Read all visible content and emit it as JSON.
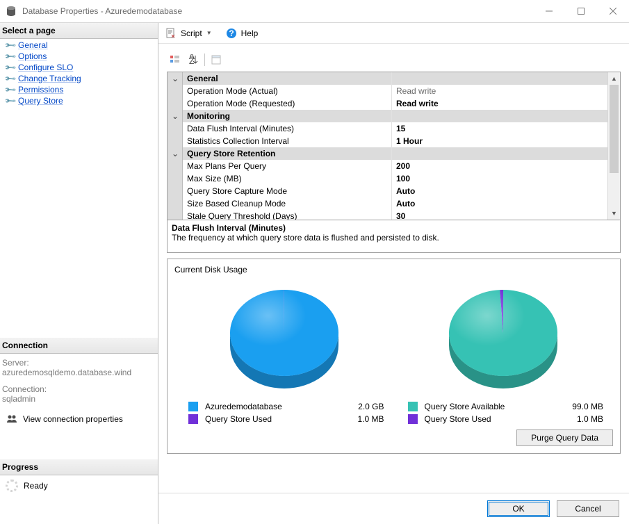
{
  "window": {
    "title": "Database Properties - Azuredemodatabase"
  },
  "toolbar": {
    "script": "Script",
    "help": "Help"
  },
  "sidebar": {
    "header": "Select a page",
    "items": [
      "General",
      "Options",
      "Configure SLO",
      "Change Tracking",
      "Permissions",
      "Query Store"
    ]
  },
  "connection": {
    "header": "Connection",
    "server_lbl": "Server:",
    "server": "azuredemosqldemo.database.wind",
    "conn_lbl": "Connection:",
    "conn": "sqladmin",
    "view": "View connection properties"
  },
  "progress": {
    "header": "Progress",
    "status": "Ready"
  },
  "propgrid": {
    "groups": [
      {
        "name": "General",
        "rows": [
          {
            "k": "Operation Mode (Actual)",
            "v": "Read write",
            "style": "dim"
          },
          {
            "k": "Operation Mode (Requested)",
            "v": "Read write",
            "style": "bold"
          }
        ]
      },
      {
        "name": "Monitoring",
        "rows": [
          {
            "k": "Data Flush Interval (Minutes)",
            "v": "15",
            "style": "bold"
          },
          {
            "k": "Statistics Collection Interval",
            "v": "1 Hour",
            "style": "bold"
          }
        ]
      },
      {
        "name": "Query Store Retention",
        "rows": [
          {
            "k": "Max Plans Per Query",
            "v": "200",
            "style": "bold"
          },
          {
            "k": "Max Size (MB)",
            "v": "100",
            "style": "bold"
          },
          {
            "k": "Query Store Capture Mode",
            "v": "Auto",
            "style": "bold"
          },
          {
            "k": "Size Based Cleanup Mode",
            "v": "Auto",
            "style": "bold"
          },
          {
            "k": "Stale Query Threshold (Days)",
            "v": "30",
            "style": "bold"
          }
        ]
      }
    ]
  },
  "description": {
    "title": "Data Flush Interval (Minutes)",
    "text": "The frequency at which query store data is flushed and persisted to disk."
  },
  "disk": {
    "title": "Current Disk Usage",
    "purge": "Purge Query Data",
    "left_legend": [
      {
        "label": "Azuredemodatabase",
        "value": "2.0 GB",
        "color": "#1a9ff0"
      },
      {
        "label": "Query Store Used",
        "value": "1.0 MB",
        "color": "#7030d8"
      }
    ],
    "right_legend": [
      {
        "label": "Query Store Available",
        "value": "99.0 MB",
        "color": "#36c2b4"
      },
      {
        "label": "Query Store Used",
        "value": "1.0 MB",
        "color": "#7030d8"
      }
    ]
  },
  "buttons": {
    "ok": "OK",
    "cancel": "Cancel"
  },
  "chart_data": [
    {
      "type": "pie",
      "title": "Database Disk Usage",
      "series": [
        {
          "name": "Azuredemodatabase",
          "value": 2048,
          "unit": "MB",
          "color": "#1a9ff0"
        },
        {
          "name": "Query Store Used",
          "value": 1,
          "unit": "MB",
          "color": "#7030d8"
        }
      ]
    },
    {
      "type": "pie",
      "title": "Query Store Disk Usage",
      "series": [
        {
          "name": "Query Store Available",
          "value": 99,
          "unit": "MB",
          "color": "#36c2b4"
        },
        {
          "name": "Query Store Used",
          "value": 1,
          "unit": "MB",
          "color": "#7030d8"
        }
      ]
    }
  ]
}
